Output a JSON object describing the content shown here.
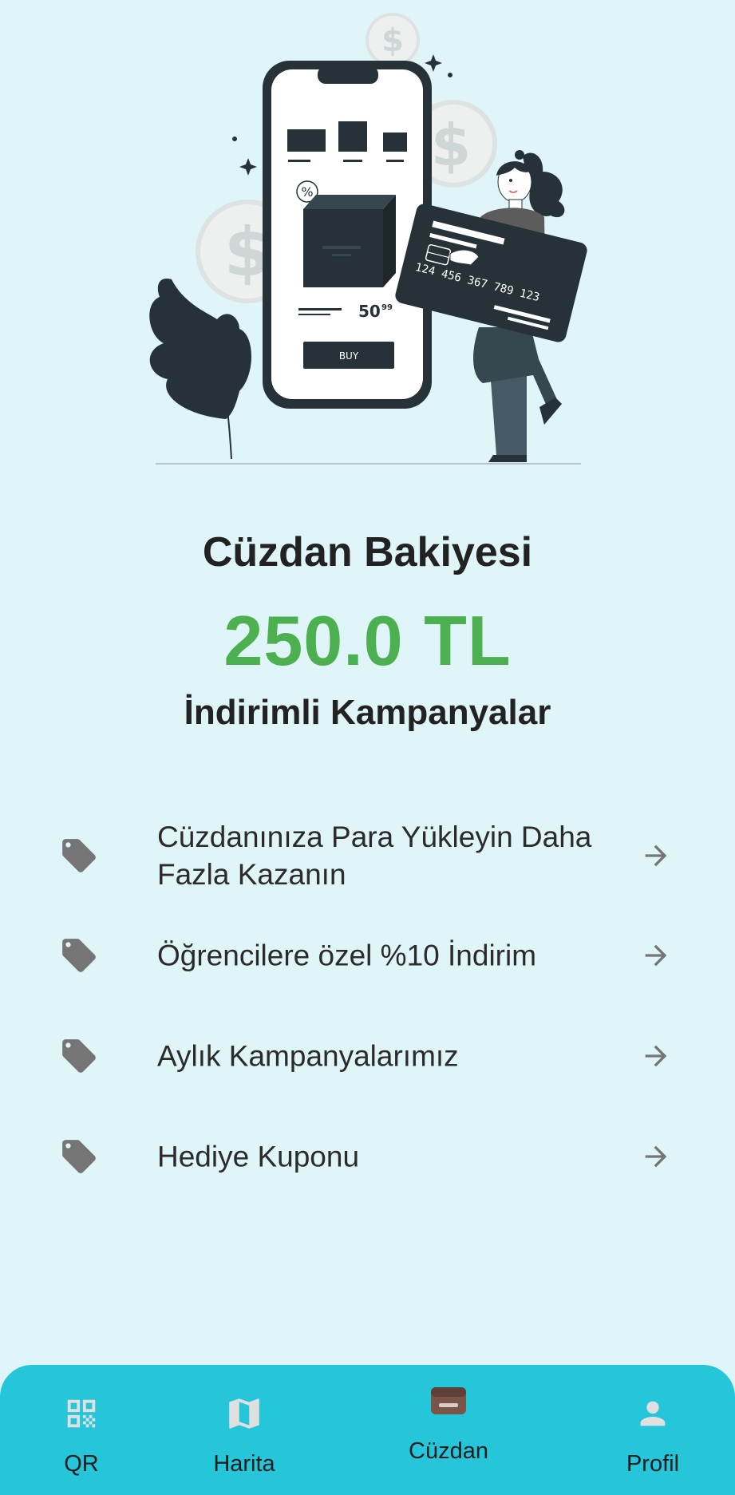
{
  "hero": {
    "phone_price": "50",
    "phone_price_cents": "99",
    "phone_buy_label": "BUY",
    "phone_discount_symbol": "%",
    "card_number": "124 456 367 789 123"
  },
  "wallet": {
    "title": "Cüzdan Bakiyesi",
    "balance": "250.0 TL",
    "balance_color": "#4caf50"
  },
  "campaigns": {
    "title": "İndirimli Kampanyalar",
    "items": [
      {
        "label": "Cüzdanınıza Para Yükleyin Daha Fazla Kazanın",
        "icon": "tag-icon",
        "action_icon": "arrow-right-icon"
      },
      {
        "label": "Öğrencilere özel %10 İndirim",
        "icon": "tag-icon",
        "action_icon": "arrow-right-icon"
      },
      {
        "label": "Aylık Kampanyalarımız",
        "icon": "tag-icon",
        "action_icon": "arrow-right-icon"
      },
      {
        "label": "Hediye Kuponu",
        "icon": "tag-icon",
        "action_icon": "arrow-right-icon"
      }
    ]
  },
  "nav": {
    "background": "#26c6da",
    "items": [
      {
        "label": "QR",
        "icon": "qr-code-icon",
        "active": false
      },
      {
        "label": "Harita",
        "icon": "map-icon",
        "active": false
      },
      {
        "label": "Cüzdan",
        "icon": "wallet-icon",
        "active": true
      },
      {
        "label": "Profil",
        "icon": "person-icon",
        "active": false
      }
    ]
  }
}
